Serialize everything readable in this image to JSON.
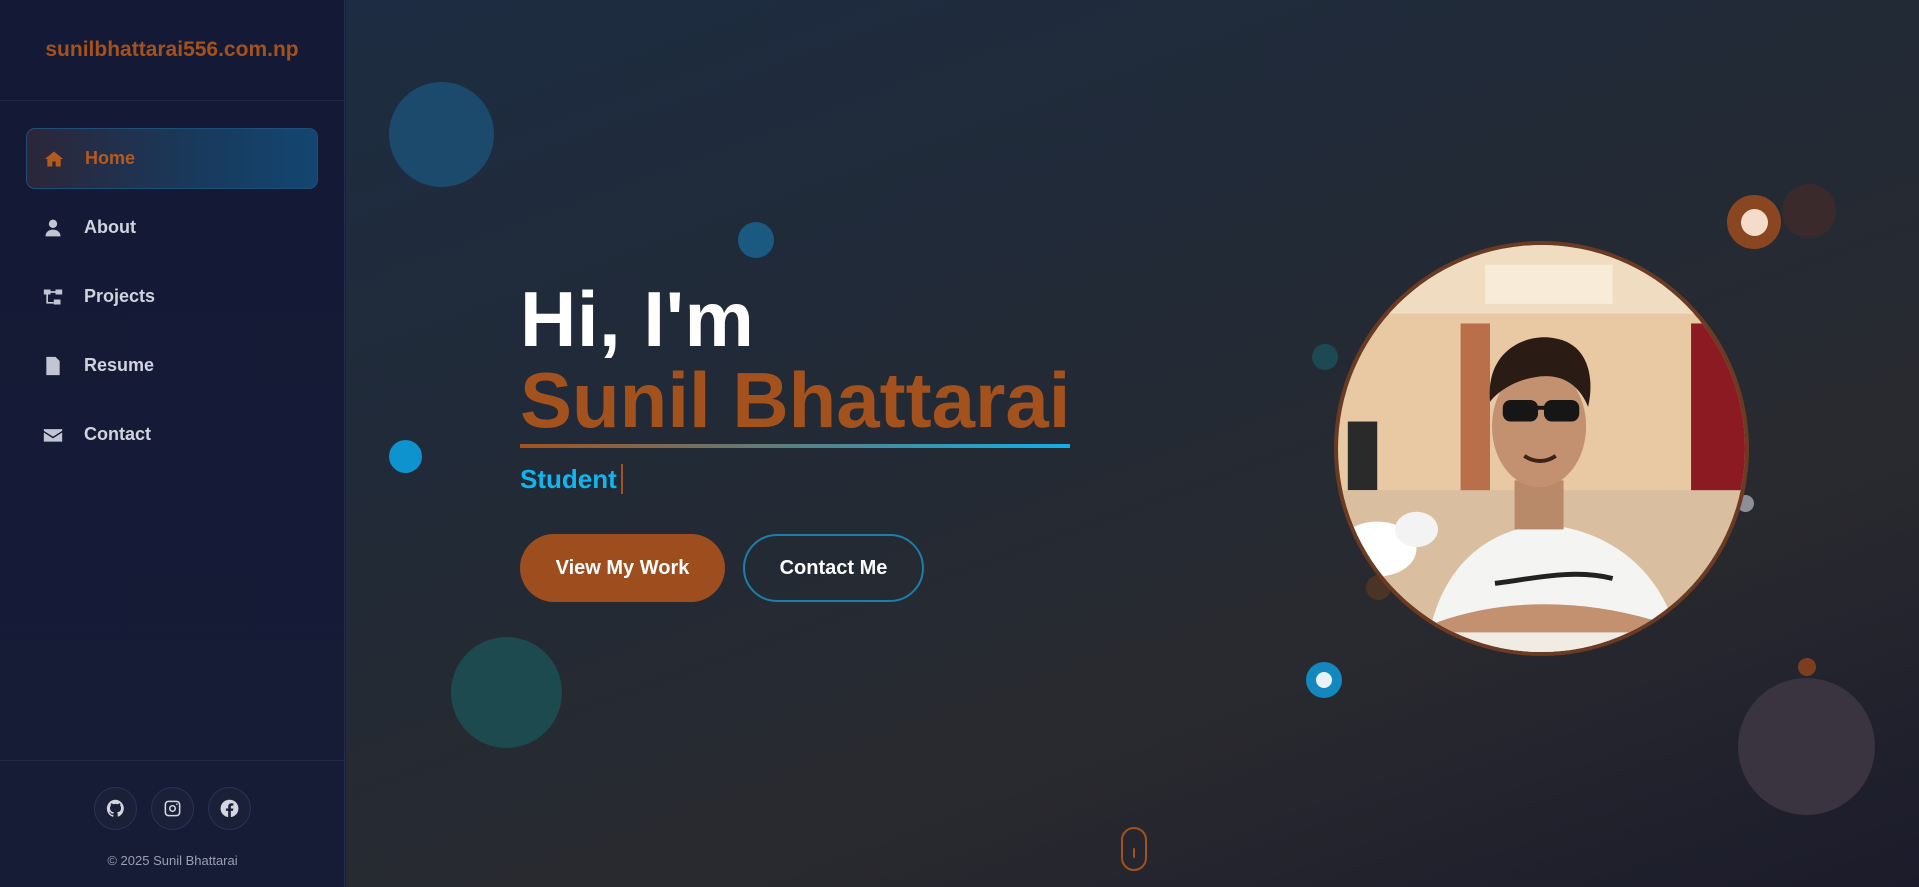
{
  "brand": {
    "title": "sunilbhattarai556.com.np"
  },
  "nav": {
    "items": [
      {
        "label": "Home",
        "icon": "home-icon",
        "active": true
      },
      {
        "label": "About",
        "icon": "user-icon",
        "active": false
      },
      {
        "label": "Projects",
        "icon": "sitemap-icon",
        "active": false
      },
      {
        "label": "Resume",
        "icon": "file-icon",
        "active": false
      },
      {
        "label": "Contact",
        "icon": "envelope-icon",
        "active": false
      }
    ]
  },
  "social": [
    {
      "name": "github-icon"
    },
    {
      "name": "instagram-icon"
    },
    {
      "name": "facebook-icon"
    }
  ],
  "footer": {
    "copyright": "© 2025 Sunil Bhattarai"
  },
  "hero": {
    "greeting": "Hi, I'm",
    "name": "Sunil Bhattarai",
    "role": "Student",
    "primary_button": "View My Work",
    "secondary_button": "Contact Me"
  },
  "colors": {
    "accent": "#a4521d",
    "highlight": "#11b6ee",
    "sidebar_bg": "#141a35",
    "text": "#ffffff"
  }
}
